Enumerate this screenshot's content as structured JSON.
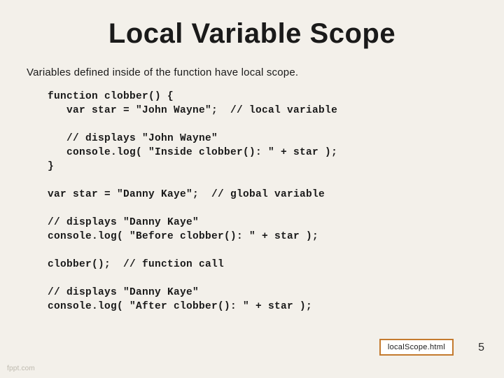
{
  "slide": {
    "title": "Local Variable Scope",
    "subtitle": "Variables defined inside of the function have local scope.",
    "code": "function clobber() {\n   var star = \"John Wayne\";  // local variable\n\n   // displays \"John Wayne\"\n   console.log( \"Inside clobber(): \" + star );\n}\n\nvar star = \"Danny Kaye\";  // global variable\n\n// displays \"Danny Kaye\"\nconsole.log( \"Before clobber(): \" + star );\n\nclobber();  // function call\n\n// displays \"Danny Kaye\"\nconsole.log( \"After clobber(): \" + star );",
    "file_badge": "localScope.html",
    "page_number": "5",
    "watermark": "fppt.com"
  }
}
